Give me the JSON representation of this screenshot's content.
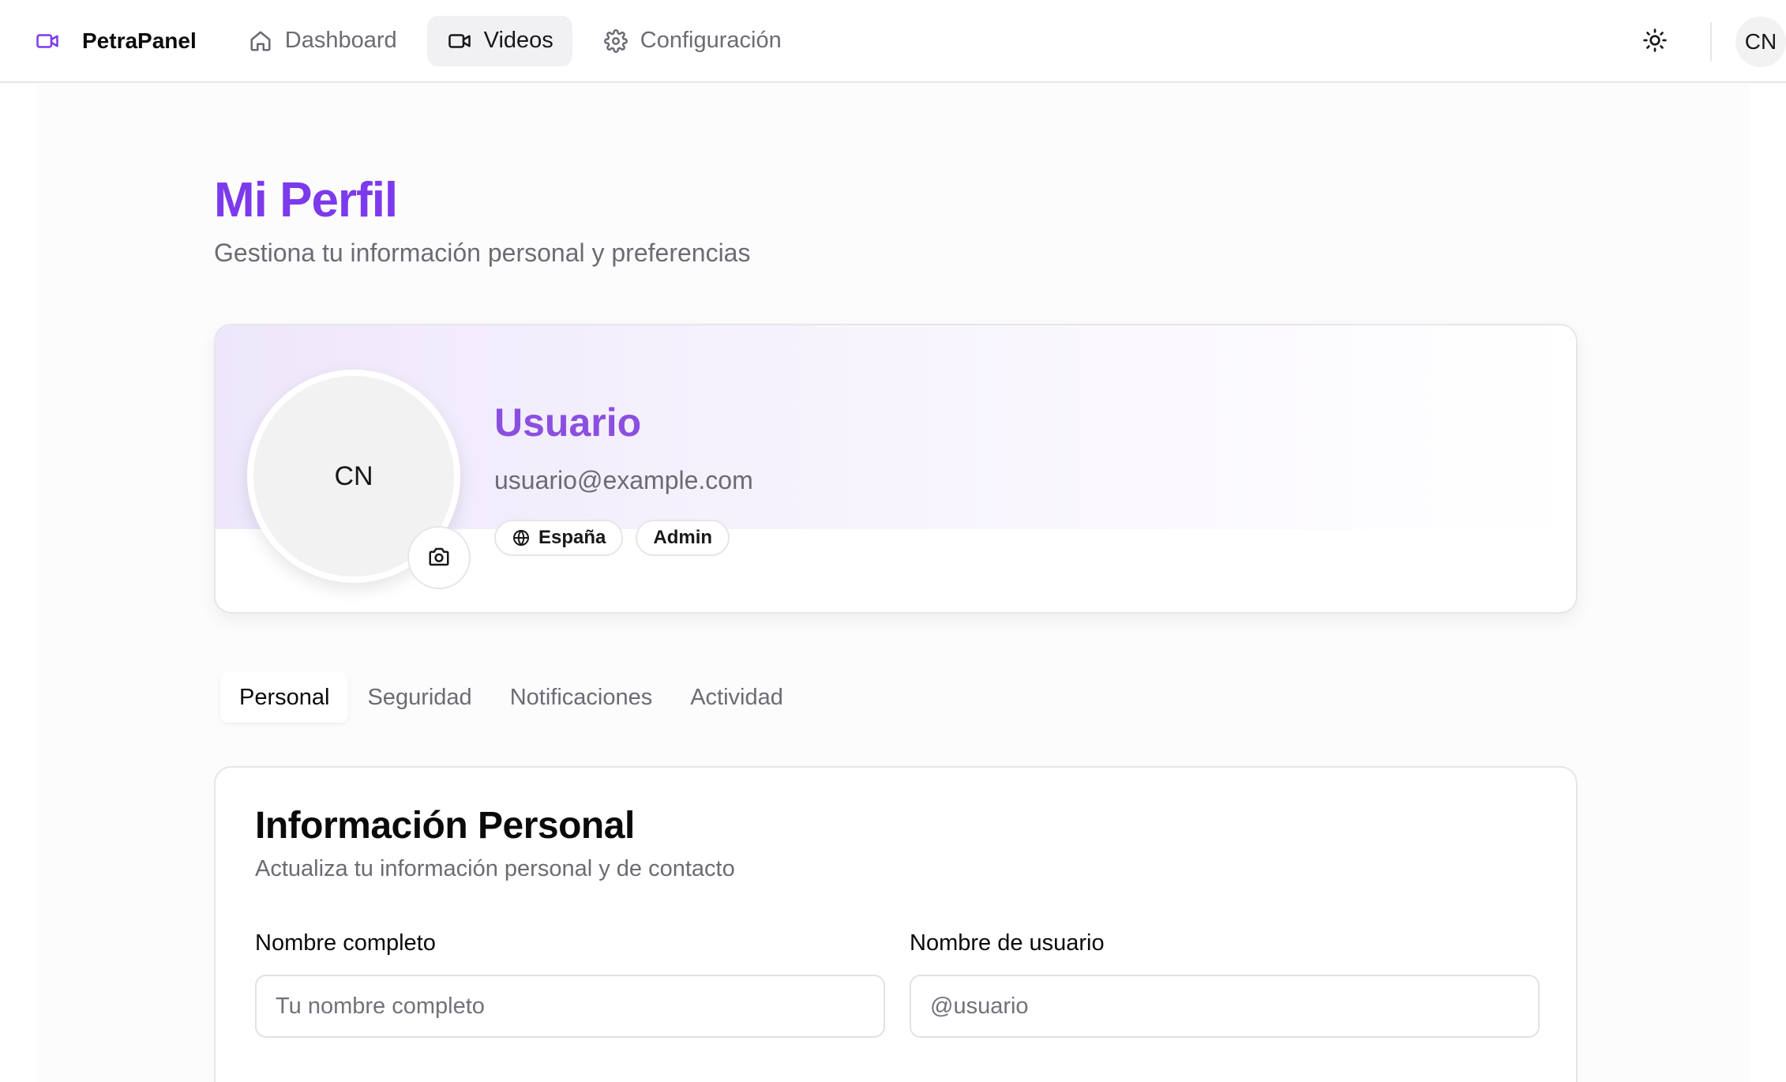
{
  "brand": {
    "name": "PetraPanel",
    "icon": "video-camera-icon",
    "color": "#7c3aed"
  },
  "nav": {
    "items": [
      {
        "label": "Dashboard",
        "icon": "home-icon",
        "active": false
      },
      {
        "label": "Videos",
        "icon": "video-icon",
        "active": true
      },
      {
        "label": "Configuración",
        "icon": "gear-icon",
        "active": false
      }
    ]
  },
  "topbar": {
    "theme_icon": "sun-icon",
    "avatar_initials": "CN"
  },
  "page": {
    "title": "Mi Perfil",
    "subtitle": "Gestiona tu información personal y preferencias"
  },
  "profile": {
    "avatar_initials": "CN",
    "camera_icon": "camera-icon",
    "name": "Usuario",
    "email": "usuario@example.com",
    "badges": [
      {
        "label": "España",
        "icon": "globe-icon"
      },
      {
        "label": "Admin"
      }
    ]
  },
  "tabs": [
    {
      "label": "Personal",
      "active": true
    },
    {
      "label": "Seguridad",
      "active": false
    },
    {
      "label": "Notificaciones",
      "active": false
    },
    {
      "label": "Actividad",
      "active": false
    }
  ],
  "personal_info": {
    "title": "Información Personal",
    "subtitle": "Actualiza tu información personal y de contacto",
    "fields": [
      {
        "label": "Nombre completo",
        "placeholder": "Tu nombre completo",
        "value": ""
      },
      {
        "label": "Nombre de usuario",
        "placeholder": "@usuario",
        "value": ""
      }
    ]
  },
  "colors": {
    "accent": "#7c3aed",
    "name_accent": "#8b4fe0",
    "muted_text": "#6b6b73",
    "border": "#e6e6e9"
  }
}
